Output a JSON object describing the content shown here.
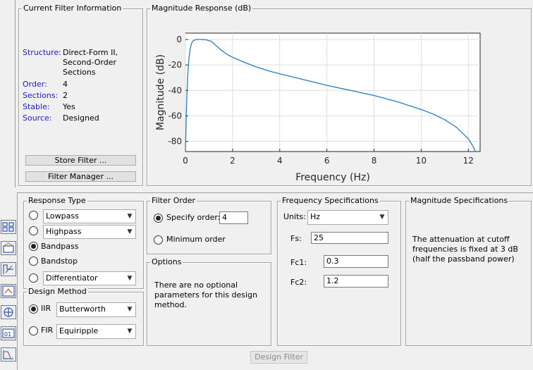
{
  "current_filter": {
    "legend": "Current Filter Information",
    "rows": [
      {
        "label": "Structure:",
        "value": "Direct-Form II,\nSecond-Order\nSections"
      },
      {
        "label": "Order:",
        "value": "4"
      },
      {
        "label": "Sections:",
        "value": "2"
      },
      {
        "label": "Stable:",
        "value": "Yes"
      },
      {
        "label": "Source:",
        "value": "Designed"
      }
    ],
    "store_button": "Store Filter ...",
    "manager_button": "Filter Manager ..."
  },
  "magnitude_panel": {
    "legend": "Magnitude Response (dB)"
  },
  "chart_data": {
    "type": "line",
    "xlabel": "Frequency (Hz)",
    "ylabel": "Magnitude (dB)",
    "xlim": [
      0,
      12.5
    ],
    "ylim": [
      -88,
      5
    ],
    "xticks": [
      0,
      2,
      4,
      6,
      8,
      10,
      12
    ],
    "xtick_labels": [
      "0",
      "2",
      "4",
      "6",
      "8",
      "10",
      "12"
    ],
    "yticks": [
      0,
      -20,
      -40,
      -60,
      -80
    ],
    "ytick_labels": [
      "0",
      "-20",
      "-40",
      "-60",
      "-80"
    ],
    "grid": true,
    "line_color": "#2a7ab9",
    "series": [
      {
        "x": [
          0.0,
          0.03,
          0.06,
          0.1,
          0.15,
          0.2,
          0.25,
          0.3,
          0.4,
          0.5,
          0.7,
          0.9,
          1.1,
          1.2,
          1.4,
          1.6,
          1.8,
          2.0,
          2.5,
          3.0,
          3.5,
          4.0,
          5.0,
          6.0,
          7.0,
          8.0,
          9.0,
          10.0,
          10.5,
          11.0,
          11.5,
          12.0,
          12.2,
          12.3
        ],
        "y": [
          -88,
          -65,
          -45,
          -28,
          -15,
          -7.5,
          -3.5,
          -1.5,
          -0.3,
          0,
          0,
          -0.3,
          -1.5,
          -3,
          -6.5,
          -9.5,
          -12,
          -14,
          -18,
          -21.5,
          -24.5,
          -27,
          -31.5,
          -36,
          -40,
          -44,
          -49,
          -55,
          -58.5,
          -63,
          -69,
          -78,
          -84,
          -88
        ]
      }
    ]
  },
  "response_type": {
    "legend": "Response Type",
    "lowpass": "Lowpass",
    "highpass": "Highpass",
    "bandpass": "Bandpass",
    "bandstop": "Bandstop",
    "differentiator": "Differentiator"
  },
  "design_method": {
    "legend": "Design Method",
    "iir": "IIR",
    "iir_value": "Butterworth",
    "fir": "FIR",
    "fir_value": "Equiripple"
  },
  "filter_order": {
    "legend": "Filter Order",
    "specify": "Specify order:",
    "order_value": "4",
    "minimum": "Minimum order"
  },
  "options": {
    "legend": "Options",
    "text": "There are no optional parameters for this design method."
  },
  "freq_spec": {
    "legend": "Frequency Specifications",
    "units_label": "Units:",
    "units_value": "Hz",
    "fs_label": "Fs:",
    "fs_value": "25",
    "fc1_label": "Fc1:",
    "fc1_value": "0.3",
    "fc2_label": "Fc2:",
    "fc2_value": "1.2"
  },
  "mag_spec": {
    "legend": "Magnitude Specifications",
    "text": "The attenuation at cutoff frequencies is fixed at 3 dB (half the passband power)"
  },
  "design_button": "Design Filter"
}
